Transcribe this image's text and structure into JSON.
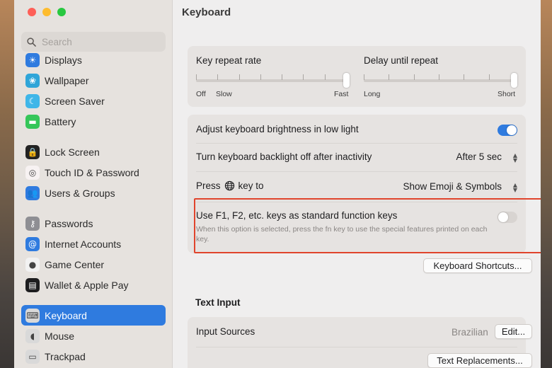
{
  "sidebar": {
    "search_placeholder": "Search",
    "items": [
      {
        "label": "Displays",
        "icon": "displays-icon",
        "color": "#2f7bdf",
        "glyph": "☀"
      },
      {
        "label": "Wallpaper",
        "icon": "wallpaper-icon",
        "color": "#2fa5d8",
        "glyph": "❀"
      },
      {
        "label": "Screen Saver",
        "icon": "screen-saver-icon",
        "color": "#3fb6e8",
        "glyph": "☾"
      },
      {
        "label": "Battery",
        "icon": "battery-icon",
        "color": "#35c659",
        "glyph": "▬"
      },
      {
        "label": "Lock Screen",
        "icon": "lock-icon",
        "color": "#222222",
        "glyph": "🔒"
      },
      {
        "label": "Touch ID & Password",
        "icon": "fingerprint-icon",
        "color": "#f7f2f2",
        "glyph": "◎"
      },
      {
        "label": "Users & Groups",
        "icon": "users-icon",
        "color": "#2f7bdf",
        "glyph": "👥"
      },
      {
        "label": "Passwords",
        "icon": "key-icon",
        "color": "#8e8e93",
        "glyph": "⚷"
      },
      {
        "label": "Internet Accounts",
        "icon": "at-icon",
        "color": "#2f7bdf",
        "glyph": "@"
      },
      {
        "label": "Game Center",
        "icon": "game-center-icon",
        "color": "#f2f2f2",
        "glyph": "●"
      },
      {
        "label": "Wallet & Apple Pay",
        "icon": "wallet-icon",
        "color": "#1d1d1f",
        "glyph": "▤"
      },
      {
        "label": "Keyboard",
        "icon": "keyboard-icon",
        "color": "#d9d9d9",
        "glyph": "⌨",
        "active": true
      },
      {
        "label": "Mouse",
        "icon": "mouse-icon",
        "color": "#d9d9d9",
        "glyph": "◖"
      },
      {
        "label": "Trackpad",
        "icon": "trackpad-icon",
        "color": "#d9d9d9",
        "glyph": "▭"
      }
    ]
  },
  "main": {
    "title": "Keyboard",
    "key_repeat": {
      "label": "Key repeat rate",
      "min_label": "Off",
      "slow_label": "Slow",
      "max_label": "Fast",
      "level": 1.0
    },
    "delay_repeat": {
      "label": "Delay until repeat",
      "min_label": "Long",
      "max_label": "Short",
      "level": 1.0
    },
    "brightness": {
      "label": "Adjust keyboard brightness in low light",
      "on": true
    },
    "backlight": {
      "label": "Turn keyboard backlight off after inactivity",
      "value": "After 5 sec"
    },
    "press_key": {
      "label_prefix": "Press",
      "label_suffix": "key to",
      "value": "Show Emoji & Symbols"
    },
    "fn_keys": {
      "label": "Use F1, F2, etc. keys as standard function keys",
      "description": "When this option is selected, press the fn key to use the special features printed on each key.",
      "on": false
    },
    "shortcuts_button": "Keyboard Shortcuts...",
    "text_input": {
      "title": "Text Input",
      "input_sources_label": "Input Sources",
      "input_sources_value": "Brazilian",
      "edit_button": "Edit...",
      "replacements_button": "Text Replacements..."
    }
  },
  "colors": {
    "accent": "#2f7bdf",
    "highlight_border": "#e0442c"
  }
}
